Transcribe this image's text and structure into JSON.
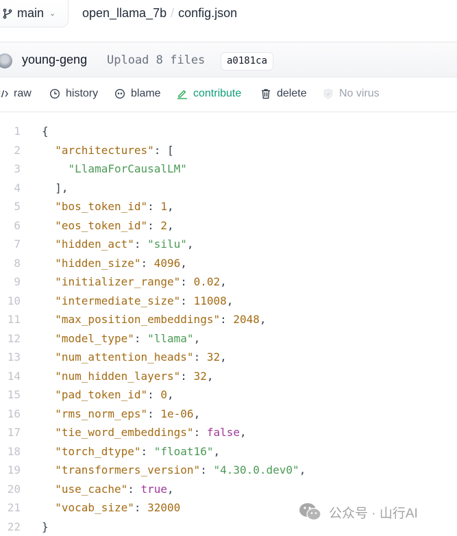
{
  "header": {
    "branch": "main",
    "breadcrumb": {
      "repo": "open_llama_7b",
      "separator": "/",
      "file": "config.json"
    }
  },
  "commit": {
    "author": "young-geng",
    "message": "Upload 8 files",
    "sha": "a0181ca"
  },
  "actions": [
    {
      "label": "raw",
      "icon": "code-icon"
    },
    {
      "label": "history",
      "icon": "clock-icon"
    },
    {
      "label": "blame",
      "icon": "face-icon"
    },
    {
      "label": "contribute",
      "icon": "pencil-icon"
    },
    {
      "label": "delete",
      "icon": "trash-icon"
    },
    {
      "label": "No virus",
      "icon": "shield-icon"
    }
  ],
  "code": {
    "lines": [
      {
        "n": "1",
        "indent": "",
        "key": "",
        "value": "{",
        "type": "punct",
        "trail": ""
      },
      {
        "n": "2",
        "indent": "  ",
        "key": "\"architectures\"",
        "value": "[",
        "type": "punct",
        "trail": ""
      },
      {
        "n": "3",
        "indent": "    ",
        "key": "",
        "value": "\"LlamaForCausalLM\"",
        "type": "string",
        "trail": ""
      },
      {
        "n": "4",
        "indent": "  ",
        "key": "",
        "value": "],",
        "type": "punct",
        "trail": ""
      },
      {
        "n": "5",
        "indent": "  ",
        "key": "\"bos_token_id\"",
        "value": "1",
        "type": "number",
        "trail": ","
      },
      {
        "n": "6",
        "indent": "  ",
        "key": "\"eos_token_id\"",
        "value": "2",
        "type": "number",
        "trail": ","
      },
      {
        "n": "7",
        "indent": "  ",
        "key": "\"hidden_act\"",
        "value": "\"silu\"",
        "type": "string",
        "trail": ","
      },
      {
        "n": "8",
        "indent": "  ",
        "key": "\"hidden_size\"",
        "value": "4096",
        "type": "number",
        "trail": ","
      },
      {
        "n": "9",
        "indent": "  ",
        "key": "\"initializer_range\"",
        "value": "0.02",
        "type": "number",
        "trail": ","
      },
      {
        "n": "10",
        "indent": "  ",
        "key": "\"intermediate_size\"",
        "value": "11008",
        "type": "number",
        "trail": ","
      },
      {
        "n": "11",
        "indent": "  ",
        "key": "\"max_position_embeddings\"",
        "value": "2048",
        "type": "number",
        "trail": ","
      },
      {
        "n": "12",
        "indent": "  ",
        "key": "\"model_type\"",
        "value": "\"llama\"",
        "type": "string",
        "trail": ","
      },
      {
        "n": "13",
        "indent": "  ",
        "key": "\"num_attention_heads\"",
        "value": "32",
        "type": "number",
        "trail": ","
      },
      {
        "n": "14",
        "indent": "  ",
        "key": "\"num_hidden_layers\"",
        "value": "32",
        "type": "number",
        "trail": ","
      },
      {
        "n": "15",
        "indent": "  ",
        "key": "\"pad_token_id\"",
        "value": "0",
        "type": "number",
        "trail": ","
      },
      {
        "n": "16",
        "indent": "  ",
        "key": "\"rms_norm_eps\"",
        "value": "1e-06",
        "type": "number",
        "trail": ","
      },
      {
        "n": "17",
        "indent": "  ",
        "key": "\"tie_word_embeddings\"",
        "value": "false",
        "type": "bool",
        "trail": ","
      },
      {
        "n": "18",
        "indent": "  ",
        "key": "\"torch_dtype\"",
        "value": "\"float16\"",
        "type": "string",
        "trail": ","
      },
      {
        "n": "19",
        "indent": "  ",
        "key": "\"transformers_version\"",
        "value": "\"4.30.0.dev0\"",
        "type": "string",
        "trail": ","
      },
      {
        "n": "20",
        "indent": "  ",
        "key": "\"use_cache\"",
        "value": "true",
        "type": "bool",
        "trail": ","
      },
      {
        "n": "21",
        "indent": "  ",
        "key": "\"vocab_size\"",
        "value": "32000",
        "type": "number",
        "trail": ""
      },
      {
        "n": "22",
        "indent": "",
        "key": "",
        "value": "}",
        "type": "punct",
        "trail": ""
      }
    ]
  },
  "watermark": {
    "text": "公众号 · 山行AI",
    "icon": "wechat-icon"
  },
  "colors": {
    "key": "#a36b14",
    "string": "#4b9a55",
    "bool": "#a0389c",
    "contribute": "#0f9d76"
  }
}
